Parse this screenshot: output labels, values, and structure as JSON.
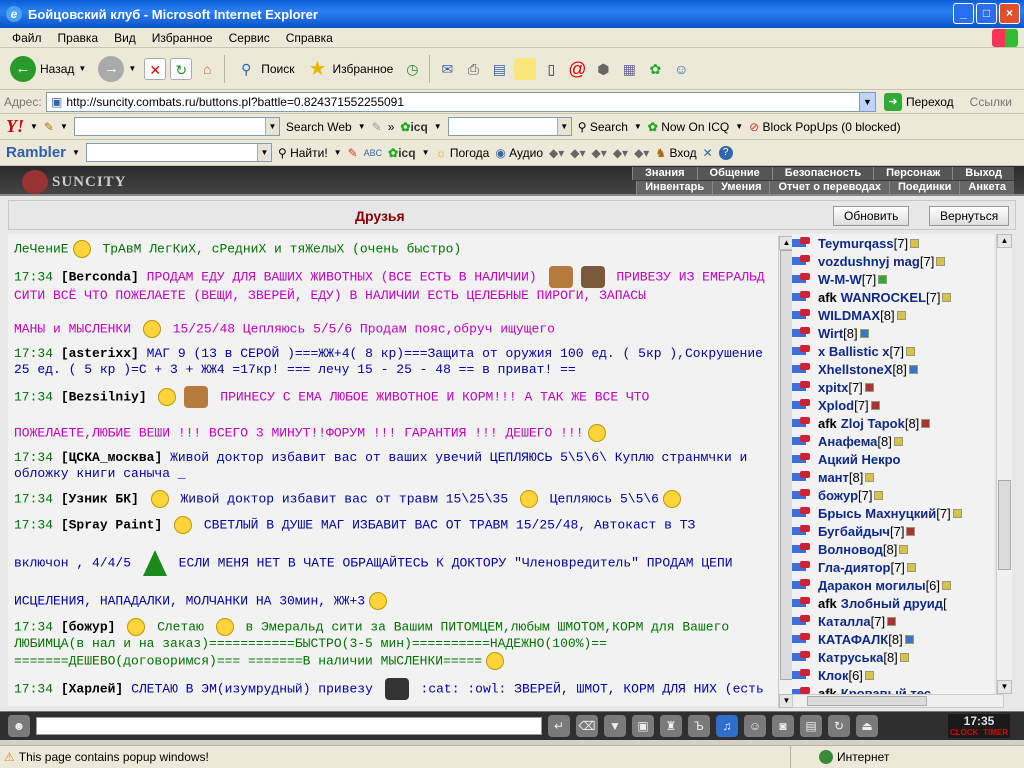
{
  "window": {
    "title": "Бойцовский клуб - Microsoft Internet Explorer"
  },
  "menu": [
    "Файл",
    "Правка",
    "Вид",
    "Избранное",
    "Сервис",
    "Справка"
  ],
  "toolbar": {
    "back": "Назад",
    "search": "Поиск",
    "favorites": "Избранное"
  },
  "address": {
    "label": "Адрес:",
    "url": "http://suncity.combats.ru/buttons.pl?battle=0.824371552255091",
    "go": "Переход",
    "links": "Ссылки"
  },
  "yahoo": {
    "logo": "Y!",
    "search_web": "Search Web",
    "more": "»",
    "icq": "icq",
    "search": "Search",
    "now_on_icq": "Now On ICQ",
    "block_popups": "Block PopUps (0 blocked)"
  },
  "rambler": {
    "logo": "Rambler",
    "find": "Найти!",
    "icq": "icq",
    "weather": "Погода",
    "audio": "Аудио",
    "login": "Вход"
  },
  "game": {
    "logo": "SUNCITY",
    "nav_top": [
      "Знания",
      "Общение",
      "Безопасность",
      "Персонаж",
      "Выход"
    ],
    "nav_bottom": [
      "Инвентарь",
      "Умения",
      "Отчет о переводах",
      "Поединки",
      "Анкета"
    ],
    "header_title": "Друзья",
    "refresh_btn": "Обновить",
    "back_btn": "Вернуться"
  },
  "chat": {
    "l0": {
      "text": "ЛеЧениЕ",
      "text2": "ТрАвМ ЛегКиХ, сРедниХ и тяЖелыХ (очень быстро)"
    },
    "l1": {
      "time": "17:34",
      "nick": "[Berconda]",
      "text": "ПРОДАМ ЕДУ ДЛЯ ВАШИХ ЖИВОТНЫХ (ВСЕ ЕСТЬ В НАЛИЧИИ)",
      "text2": "ПРИВЕЗУ ИЗ ЕМЕРАЛЬД СИТИ ВСЁ ЧТО ПОЖЕЛАЕТЕ (ВЕЩИ, ЗВЕРЕЙ, ЕДУ) В НАЛИЧИИ ЕСТЬ ЦЕЛЕБНЫЕ ПИРОГИ, ЗАПАСЫ",
      "text3": "МАНЫ и МЫСЛЕНКИ",
      "text4": "15/25/48 Цепляюсь 5/5/6 Продам пояс,обруч ищущего"
    },
    "l2": {
      "time": "17:34",
      "nick": "[asterixx]",
      "text": "МАГ 9 (13 в СЕРОЙ )===ЖЖ+4( 8 кр)===Защита от оружия 100 ед. ( 5кр ),Сокрушение 25 ед. ( 5 кр )=С + 3 + ЖЖ4 =17кр! === лечу 15 - 25 - 48 == в приват! =="
    },
    "l3": {
      "time": "17:34",
      "nick": "[Bezsilniy]",
      "text": "ПРИНЕСУ С ЕМА ЛЮБОЕ ЖИВОТНОЕ И КОРМ!!! А ТАК ЖЕ ВСЕ ЧТО",
      "text2": "ПОЖЕЛАЕТЕ,ЛЮБИЕ ВЕШИ !!! ВСЕГО 3 МИНУТ!!ФОРУМ !!! ГАРАНТИЯ !!! ДЕШЕГО !!!"
    },
    "l4": {
      "time": "17:34",
      "nick": "[ЦСКА_москва]",
      "text": "Живой доктор избавит вас от ваших увечий ЦЕПЛЯЮСЬ 5\\5\\6\\ Куплю странмчки и обложку книги саныча _"
    },
    "l5": {
      "time": "17:34",
      "nick": "[Узник БК]",
      "text": "Живой доктор избавит вас от травм 15\\25\\35",
      "text2": "Цепляюсь 5\\5\\6"
    },
    "l6": {
      "time": "17:34",
      "nick": "[Spray Paint]",
      "text": "СВЕТЛЫЙ В ДУШЕ МАГ ИЗБАВИТ ВАС ОТ ТРАВМ 15/25/48, Автокаст в ТЗ",
      "text2": "включон , 4/4/5",
      "text3": "ЕСЛИ МЕНЯ НЕТ В ЧАТЕ ОБРАЩАЙТЕСЬ К ДОКТОРУ \"Членовредитель\" ПРОДАМ ЦЕПИ",
      "text4": "ИСЦЕЛЕНИЯ, НАПАДАЛКИ, МОЛЧАНКИ НА 30мин, ЖЖ+3"
    },
    "l7": {
      "time": "17:34",
      "nick": "[божур]",
      "text": "Слетаю",
      "text2": "в Эмеральд сити за Вашим ПИТОМЦЕМ,любым ШМОТОМ,КОРМ для Вашего ЛЮБИМЦА(в нал и на заказ)===========БЫСТРО(3-5 мин)==========НАДЕЖНО(100%)==",
      "text3": "=======ДЕШЕВО(договоримся)=== =======В наличии МЫСЛЕНКИ====="
    },
    "l8": {
      "time": "17:34",
      "nick": "[Харлей]",
      "text": "СЛЕТАЮ В ЭМ(изумрудный) привезу",
      "text2": ":cat: :owl: ЗВЕРЕЙ, ШМОТ, КОРМ ДЛЯ НИХ (есть"
    }
  },
  "users": [
    {
      "name": "Teymurqass",
      "lv": "[7]",
      "info": "y"
    },
    {
      "name": "vozdushnyj mag",
      "lv": "[7]",
      "info": "y"
    },
    {
      "name": "W-M-W",
      "lv": "[7]",
      "info": "grn"
    },
    {
      "afk": "afk",
      "name": "WANROCKEL",
      "lv": "[7]",
      "info": "y"
    },
    {
      "name": "WILDMAX",
      "lv": "[8]",
      "info": "y"
    },
    {
      "name": "Wirt",
      "lv": "[8]",
      "info": "blue"
    },
    {
      "name": "x Ballistic x",
      "lv": "[7]",
      "info": "y"
    },
    {
      "name": "XhellstoneX",
      "lv": "[8]",
      "info": "blue"
    },
    {
      "name": "xpitx",
      "lv": "[7]",
      "info": "red"
    },
    {
      "name": "Xplod",
      "lv": "[7]",
      "info": "red"
    },
    {
      "afk": "afk",
      "name": "Zloj Tapok",
      "lv": "[8]",
      "info": "red"
    },
    {
      "name": "Анафема",
      "lv": "[8]",
      "info": "y"
    },
    {
      "name": "Ацкий Некро",
      "lv": "",
      "info": ""
    },
    {
      "name": "мант",
      "lv": "[8]",
      "info": "y"
    },
    {
      "name": "божур",
      "lv": "[7]",
      "info": "y"
    },
    {
      "name": "Брысь Махнуцкий",
      "lv": "[7]",
      "info": "y"
    },
    {
      "name": "Бугбайдыч",
      "lv": "[7]",
      "info": "red"
    },
    {
      "name": "Волновод",
      "lv": "[8]",
      "info": "y"
    },
    {
      "name": "Гла-диятор",
      "lv": "[7]",
      "info": "y"
    },
    {
      "name": "Даракон могилы",
      "lv": "[6]",
      "info": "y"
    },
    {
      "afk": "afk",
      "name": "Злобный друид",
      "lv": "[",
      "info": ""
    },
    {
      "name": "Каталла",
      "lv": "[7]",
      "info": "red"
    },
    {
      "name": "КАТАФАЛК",
      "lv": "[8]",
      "info": "blue"
    },
    {
      "name": "Катруська",
      "lv": "[8]",
      "info": "y"
    },
    {
      "name": "Клок",
      "lv": "[6]",
      "info": "y"
    },
    {
      "afk": "afk",
      "name": "Кровавый тес...",
      "lv": "",
      "info": ""
    }
  ],
  "bottom": {
    "clock_time": "17:35",
    "clock_label": "CLOCK",
    "timer_label": "TIMER"
  },
  "status": {
    "msg": "This page contains popup windows!",
    "zone": "Интернет"
  }
}
